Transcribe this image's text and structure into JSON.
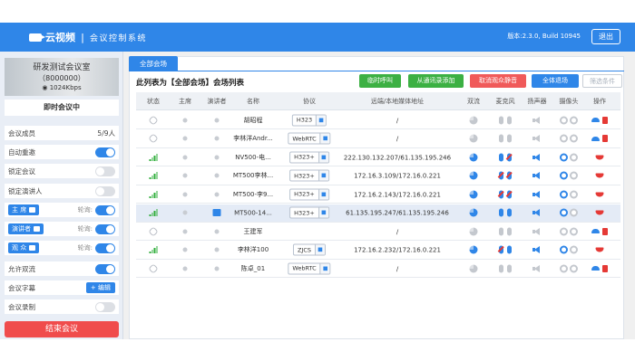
{
  "app": {
    "name": "云视频",
    "subtitle": "会议控制系统",
    "version": "版本:2.3.0, Build 10945",
    "exit_label": "退出"
  },
  "room": {
    "name": "研发测试会议室",
    "number": "（8000000）",
    "rate": "◉ 1024Kbps",
    "status": "即时会议中"
  },
  "settings": {
    "members_label": "会议成员",
    "members_value": "5/9人",
    "auto_redial": "自动重邀",
    "lock_meeting": "锁定会议",
    "lock_presenter": "锁定演讲人",
    "chair_label": "主 席",
    "presenter_label": "演讲者",
    "audience_label": "观 众",
    "poll_label": "轮询:",
    "allow_dual": "允许双流",
    "subtitle_label": "会议字幕",
    "edit_label": "+ 编辑",
    "record_label": "会议录制",
    "end_meeting": "结束会议"
  },
  "tab": {
    "all": "全部会场"
  },
  "list_title": "此列表为【全部会场】会场列表",
  "actions": [
    {
      "label": "临时呼叫",
      "color": "#3cb043"
    },
    {
      "label": "从通讯录添加",
      "color": "#3cb043"
    },
    {
      "label": "取消观众静音",
      "color": "#f05a5a"
    },
    {
      "label": "全体退场",
      "color": "#2f86e8"
    },
    {
      "label": "筛选条件",
      "color": "#cfd4da"
    }
  ],
  "columns": [
    "状态",
    "主席",
    "演讲者",
    "名称",
    "协议",
    "远端/本地媒体地址",
    "双流",
    "麦克风",
    "扬声器",
    "摄像头",
    "操作"
  ],
  "rows": [
    {
      "name": "胡昭程",
      "protocol": "H323",
      "address": "/",
      "online": false,
      "selected": false,
      "presenter": false
    },
    {
      "name": "李林洋Andr...",
      "protocol": "WebRTC",
      "address": "/",
      "online": false,
      "selected": false,
      "presenter": false
    },
    {
      "name": "NV500-电...",
      "protocol": "H323+",
      "address": "222.130.132.207/61.135.195.246",
      "online": true,
      "selected": false,
      "presenter": false
    },
    {
      "name": "MT500李林...",
      "protocol": "H323+",
      "address": "172.16.3.109/172.16.0.221",
      "online": true,
      "selected": false,
      "presenter": false
    },
    {
      "name": "MT500-李9...",
      "protocol": "H323+",
      "address": "172.16.2.143/172.16.0.221",
      "online": true,
      "selected": false,
      "presenter": false
    },
    {
      "name": "MT500-14...",
      "protocol": "H323+",
      "address": "61.135.195.247/61.135.195.246",
      "online": true,
      "selected": true,
      "presenter": true
    },
    {
      "name": "王建军",
      "protocol": "",
      "address": "/",
      "online": false,
      "selected": false,
      "presenter": false
    },
    {
      "name": "李林洋100",
      "protocol": "ZJCS",
      "address": "172.16.2.232/172.16.0.221",
      "online": true,
      "selected": false,
      "presenter": false
    },
    {
      "name": "陈卓_01",
      "protocol": "WebRTC",
      "address": "/",
      "online": false,
      "selected": false,
      "presenter": false
    }
  ]
}
